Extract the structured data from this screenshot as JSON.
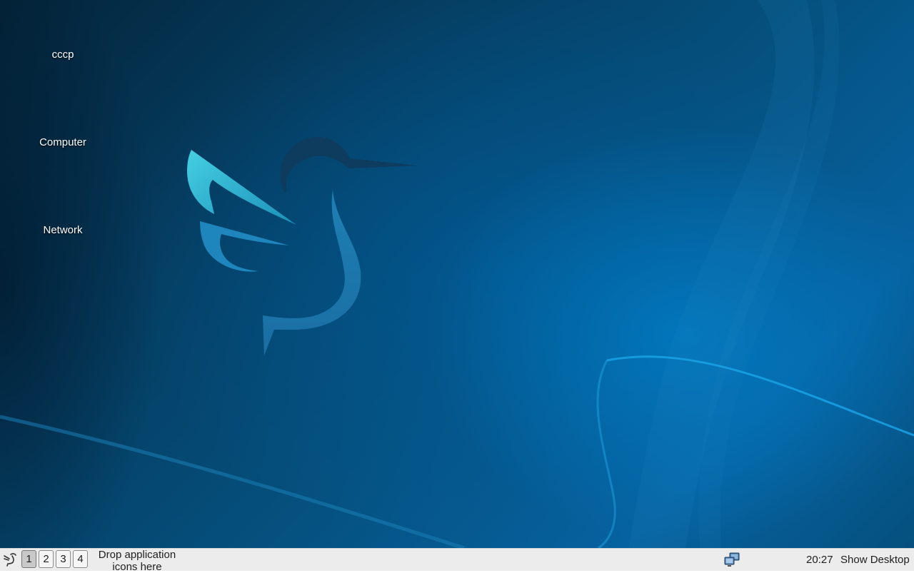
{
  "desktop": {
    "icons": [
      {
        "label": "cccp"
      },
      {
        "label": "Computer"
      },
      {
        "label": "Network"
      }
    ]
  },
  "taskbar": {
    "start_icon": "dove-logo-icon",
    "workspaces": [
      "1",
      "2",
      "3",
      "4"
    ],
    "active_workspace": "1",
    "launcher_hint": "Drop application icons here",
    "tray_icon": "network-status-icon",
    "clock": "20:27",
    "show_desktop": "Show Desktop"
  },
  "colors": {
    "taskbar_bg": "#ececec",
    "wallpaper_dark": "#03243a",
    "wallpaper_light": "#0662a0",
    "bird_accent": "#3fc9df"
  }
}
